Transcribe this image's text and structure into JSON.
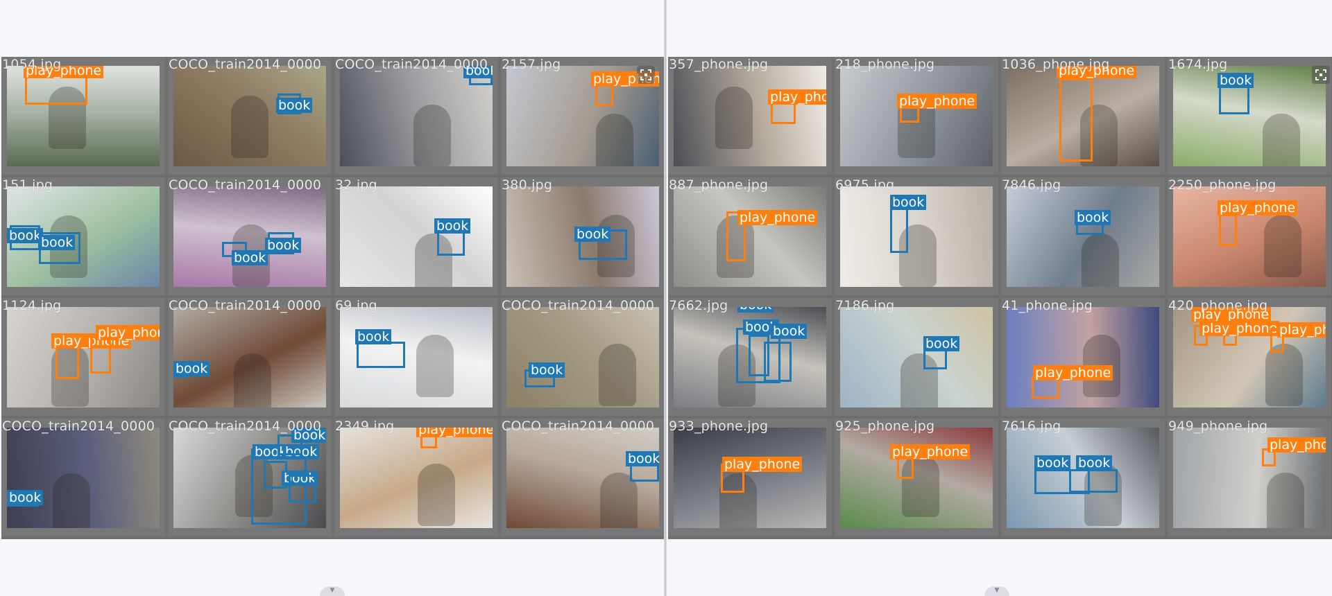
{
  "colors": {
    "play_phone": "#ff7f0e",
    "book": "#1f77b4",
    "tile_background": "#777777"
  },
  "icons": {
    "expand": "expand-icon",
    "scroll": "chevron-down-icon"
  },
  "panels": [
    {
      "tiles": [
        {
          "filename": "1054.jpg",
          "scene": [
            "#5a6b52",
            "#a8b4a6",
            "#dfe3df"
          ],
          "detections": [
            {
              "label": "play_phone"
            }
          ]
        },
        {
          "filename": "COCO_train2014_0000",
          "scene": [
            "#6b5a44",
            "#8d7b62",
            "#a9a68a"
          ],
          "detections": [
            {
              "label": "book"
            }
          ]
        },
        {
          "filename": "COCO_train2014_0000",
          "scene": [
            "#4c4f58",
            "#9fa0a4",
            "#d3d1cc"
          ],
          "detections": [
            {
              "label": "book"
            }
          ]
        },
        {
          "filename": "2157.jpg",
          "scene": [
            "#c4c8d0",
            "#a39b90",
            "#4b5f72"
          ],
          "detections": [
            {
              "label": "play_phone"
            }
          ]
        },
        {
          "filename": "151.jpg",
          "scene": [
            "#dfe4e6",
            "#9ec0a0",
            "#6c86a6"
          ],
          "detections": [
            {
              "label": "book"
            },
            {
              "label": "book"
            }
          ]
        },
        {
          "filename": "COCO_train2014_0000",
          "scene": [
            "#a879a8",
            "#cfc2cf",
            "#7c6b82"
          ],
          "detections": [
            {
              "label": "book"
            },
            {
              "label": "book"
            }
          ]
        },
        {
          "filename": "32.jpg",
          "scene": [
            "#e6e6e8",
            "#d2d2d4",
            "#ffffff"
          ],
          "detections": [
            {
              "label": "book"
            }
          ]
        },
        {
          "filename": "380.jpg",
          "scene": [
            "#c9c0b6",
            "#8a7a6d",
            "#ccc7d8"
          ],
          "detections": [
            {
              "label": "book"
            }
          ]
        },
        {
          "filename": "1124.jpg",
          "scene": [
            "#d7d4cf",
            "#b4b1ad",
            "#8a8680"
          ],
          "detections": [
            {
              "label": "play_phone"
            },
            {
              "label": "play_phone"
            }
          ]
        },
        {
          "filename": "COCO_train2014_0000",
          "scene": [
            "#b1aca5",
            "#6f4a37",
            "#cdc8bf"
          ],
          "detections": [
            {
              "label": "book"
            }
          ]
        },
        {
          "filename": "69.jpg",
          "scene": [
            "#d9dadc",
            "#f2f2f2",
            "#b9bec6"
          ],
          "detections": [
            {
              "label": "book"
            }
          ]
        },
        {
          "filename": "COCO_train2014_0000",
          "scene": [
            "#8b8066",
            "#a59a84",
            "#c9c2b1"
          ],
          "detections": [
            {
              "label": "book"
            }
          ]
        },
        {
          "filename": "COCO_train2014_0000",
          "scene": [
            "#3d3f52",
            "#5b5f7c",
            "#8f8a7c"
          ],
          "detections": [
            {
              "label": "book"
            }
          ]
        },
        {
          "filename": "COCO_train2014_0000",
          "scene": [
            "#d8d8da",
            "#8c8a86",
            "#4b4c50"
          ],
          "detections": [
            {
              "label": "book"
            },
            {
              "label": "book"
            },
            {
              "label": "book"
            },
            {
              "label": "book"
            }
          ]
        },
        {
          "filename": "2349.jpg",
          "scene": [
            "#e5e2dc",
            "#c6a98a",
            "#e9e5df"
          ],
          "detections": [
            {
              "label": "play_phone"
            }
          ]
        },
        {
          "filename": "COCO_train2014_0000",
          "scene": [
            "#6e4a37",
            "#b5a799",
            "#d2cdc6"
          ],
          "detections": [
            {
              "label": "book"
            }
          ]
        }
      ]
    },
    {
      "tiles": [
        {
          "filename": "357_phone.jpg",
          "scene": [
            "#4b4e54",
            "#b3a99d",
            "#f0ece5"
          ],
          "detections": [
            {
              "label": "play_phone"
            }
          ]
        },
        {
          "filename": "218_phone.jpg",
          "scene": [
            "#c9cbcf",
            "#8f969c",
            "#5c6168"
          ],
          "detections": [
            {
              "label": "play_phone"
            }
          ]
        },
        {
          "filename": "1036_phone.jpg",
          "scene": [
            "#7c6e63",
            "#b9aea3",
            "#5a4e46"
          ],
          "detections": [
            {
              "label": "play_phone"
            }
          ]
        },
        {
          "filename": "1674.jpg",
          "scene": [
            "#8cac6a",
            "#d5d9cb",
            "#5f7e45"
          ],
          "detections": [
            {
              "label": "book"
            }
          ]
        },
        {
          "filename": "887_phone.jpg",
          "scene": [
            "#8b8b88",
            "#c6c6c1",
            "#7a7a76"
          ],
          "detections": [
            {
              "label": "play_phone"
            }
          ]
        },
        {
          "filename": "6975.jpg",
          "scene": [
            "#efece7",
            "#d8d3cb",
            "#b9b0a6"
          ],
          "detections": [
            {
              "label": "book"
            }
          ]
        },
        {
          "filename": "7846.jpg",
          "scene": [
            "#c5cdd8",
            "#6f7c8a",
            "#a7a9a6"
          ],
          "detections": [
            {
              "label": "book"
            }
          ]
        },
        {
          "filename": "2250_phone.jpg",
          "scene": [
            "#e7b6a3",
            "#c9866e",
            "#8a5a4c"
          ],
          "detections": [
            {
              "label": "play_phone"
            }
          ]
        },
        {
          "filename": "7662.jpg",
          "scene": [
            "#7a7d83",
            "#c6c2bb",
            "#4b4e55"
          ],
          "detections": [
            {
              "label": "book"
            },
            {
              "label": "book"
            },
            {
              "label": "book"
            }
          ]
        },
        {
          "filename": "7186.jpg",
          "scene": [
            "#9fb3c5",
            "#c9d3cf",
            "#cfc3a4"
          ],
          "detections": [
            {
              "label": "book"
            }
          ]
        },
        {
          "filename": "41_phone.jpg",
          "scene": [
            "#6a7fc2",
            "#c3a2a0",
            "#3d4a7e"
          ],
          "detections": [
            {
              "label": "play_phone"
            }
          ]
        },
        {
          "filename": "420_phone.jpg",
          "scene": [
            "#a49684",
            "#d2c7b6",
            "#5e7b8d"
          ],
          "detections": [
            {
              "label": "play_phone"
            },
            {
              "label": "play_phone"
            },
            {
              "label": "play_phone"
            }
          ]
        },
        {
          "filename": "933_phone.jpg",
          "scene": [
            "#3a3d44",
            "#7b7f87",
            "#b8b6b1"
          ],
          "detections": [
            {
              "label": "play_phone"
            }
          ]
        },
        {
          "filename": "925_phone.jpg",
          "scene": [
            "#5a8a4d",
            "#b3aaa3",
            "#8a3b3b"
          ],
          "detections": [
            {
              "label": "play_phone"
            }
          ]
        },
        {
          "filename": "7616.jpg",
          "scene": [
            "#7b98b0",
            "#c8cfd4",
            "#545a5e"
          ],
          "detections": [
            {
              "label": "book"
            },
            {
              "label": "book"
            }
          ]
        },
        {
          "filename": "949_phone.jpg",
          "scene": [
            "#9ea3a8",
            "#d1cfcb",
            "#6b6f73"
          ],
          "detections": [
            {
              "label": "play_phone"
            }
          ]
        }
      ]
    }
  ]
}
